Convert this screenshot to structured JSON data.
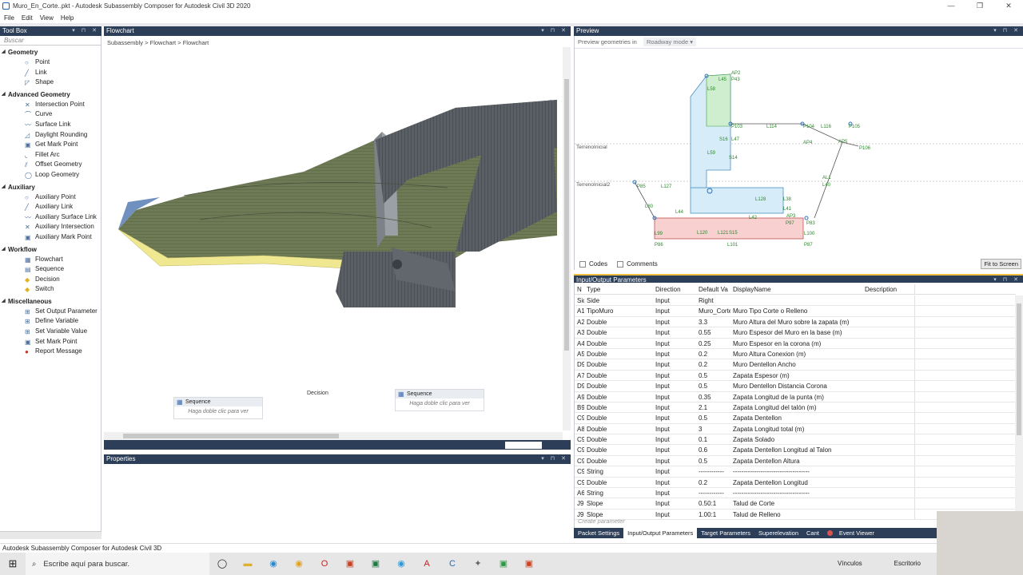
{
  "window": {
    "title": "Muro_En_Corte..pkt - Autodesk Subassembly Composer for Autodesk Civil 3D 2020",
    "controls": [
      "—",
      "❐",
      "✕"
    ]
  },
  "menu": [
    "File",
    "Edit",
    "View",
    "Help"
  ],
  "toolbox": {
    "title": "Tool Box",
    "search_placeholder": "Buscar",
    "groups": [
      {
        "name": "Geometry",
        "items": [
          "Point",
          "Link",
          "Shape"
        ]
      },
      {
        "name": "Advanced Geometry",
        "items": [
          "Intersection Point",
          "Curve",
          "Surface Link",
          "Daylight Rounding",
          "Get Mark Point",
          "Fillet Arc",
          "Offset Geometry",
          "Loop Geometry"
        ]
      },
      {
        "name": "Auxiliary",
        "items": [
          "Auxiliary Point",
          "Auxiliary Link",
          "Auxiliary Surface Link",
          "Auxiliary Intersection",
          "Auxiliary Mark Point"
        ]
      },
      {
        "name": "Workflow",
        "items": [
          "Flowchart",
          "Sequence",
          "Decision",
          "Switch"
        ]
      },
      {
        "name": "Miscellaneous",
        "items": [
          "Set Output Parameter",
          "Define Variable",
          "Set Variable Value",
          "Set Mark Point",
          "Report Message"
        ]
      }
    ]
  },
  "flowchart": {
    "title": "Flowchart",
    "breadcrumb": [
      "Subassembly",
      ">",
      "Flowchart",
      ">",
      "Flowchart"
    ],
    "sequence_left": {
      "title": "Sequence",
      "hint": "Haga doble clic para ver"
    },
    "decision_label": "Decision",
    "sequence_right": {
      "title": "Sequence",
      "hint": "Haga doble clic para ver"
    }
  },
  "properties": {
    "title": "Properties"
  },
  "preview": {
    "title": "Preview",
    "geom_label": "Preview geometries in",
    "mode": "Roadway mode",
    "codes_label": "Codes",
    "comments_label": "Comments",
    "fit_button": "Fit to Screen",
    "surface_labels": [
      "TerrenoInicial",
      "TerrenoInicial2"
    ],
    "point_labels": [
      "AP2",
      "P43",
      "L45",
      "L58",
      "P103",
      "L114",
      "P104",
      "L116",
      "P105",
      "S16",
      "L47",
      "P106",
      "AP4",
      "AP5",
      "L59",
      "S14",
      "AL1",
      "L40",
      "L127",
      "L38",
      "L41",
      "L42",
      "L128",
      "AP3",
      "P83",
      "S15",
      "L99",
      "L100",
      "L101",
      "P86",
      "P87",
      "P85",
      "L80",
      "L44",
      "L120",
      "L121",
      "P97"
    ]
  },
  "io": {
    "title": "Input/Output Parameters",
    "columns": [
      "N",
      "Type",
      "Direction",
      "Default Va",
      "DisplayName",
      "Description"
    ],
    "rows": [
      [
        "Sid",
        "Side",
        "Input",
        "Right",
        "",
        ""
      ],
      [
        "A1",
        "TipoMuro",
        "Input",
        "Muro_Corte",
        "Muro Tipo Corte o Relleno",
        ""
      ],
      [
        "A2",
        "Double",
        "Input",
        "3.3",
        "Muro Altura del Muro sobre la zapata (m)",
        ""
      ],
      [
        "A3",
        "Double",
        "Input",
        "0.55",
        "Muro Espesor del Muro en la base (m)",
        ""
      ],
      [
        "A4",
        "Double",
        "Input",
        "0.25",
        "Muro  Espesor en la corona (m)",
        ""
      ],
      [
        "A5",
        "Double",
        "Input",
        "0.2",
        "Muro Altura Conexion (m)",
        ""
      ],
      [
        "D9",
        "Double",
        "Input",
        "0.2",
        "Muro Dentellon Ancho",
        ""
      ],
      [
        "A7",
        "Double",
        "Input",
        "0.5",
        "Zapata Espesor (m)",
        ""
      ],
      [
        "D9",
        "Double",
        "Input",
        "0.5",
        "Muro Dentellon Distancia Corona",
        ""
      ],
      [
        "A9",
        "Double",
        "Input",
        "0.35",
        "Zapata Longitud de la punta (m)",
        ""
      ],
      [
        "B9",
        "Double",
        "Input",
        "2.1",
        "Zapata Longitud del talón (m)",
        ""
      ],
      [
        "C9",
        "Double",
        "Input",
        "0.5",
        "Zapata Dentellon",
        ""
      ],
      [
        "A8",
        "Double",
        "Input",
        "3",
        "Zapata Longitud total (m)",
        ""
      ],
      [
        "C9",
        "Double",
        "Input",
        "0.1",
        "Zapata Solado",
        ""
      ],
      [
        "C9",
        "Double",
        "Input",
        "0.6",
        "Zapata Dentellon Longitud al Talon",
        ""
      ],
      [
        "C9",
        "Double",
        "Input",
        "0.5",
        "Zapata Dentellon Altura",
        ""
      ],
      [
        "C9",
        "String",
        "Input",
        "------------",
        "------------------------------------",
        ""
      ],
      [
        "C9",
        "Double",
        "Input",
        "0.2",
        "Zapata Dentellon Longitud",
        ""
      ],
      [
        "A6",
        "String",
        "Input",
        "------------",
        "------------------------------------",
        ""
      ],
      [
        "J9",
        "Slope",
        "Input",
        "0.50:1",
        "Talud de Corte",
        ""
      ],
      [
        "J95",
        "Slope",
        "Input",
        "1.00:1",
        "Talud de Relleno",
        ""
      ]
    ],
    "create_placeholder": "Create parameter"
  },
  "bottom_tabs": [
    "Packet Settings",
    "Input/Output Parameters",
    "Target Parameters",
    "Superelevation",
    "Cant",
    "Event Viewer"
  ],
  "status": "Autodesk Subassembly Composer for Autodesk Civil 3D",
  "taskbar": {
    "search": "Escribe aquí para buscar.",
    "tray": [
      "Vínculos",
      "Escritorio"
    ]
  },
  "colors": {
    "panel_header": "#2c3e58",
    "accent": "#1d5fa8"
  }
}
